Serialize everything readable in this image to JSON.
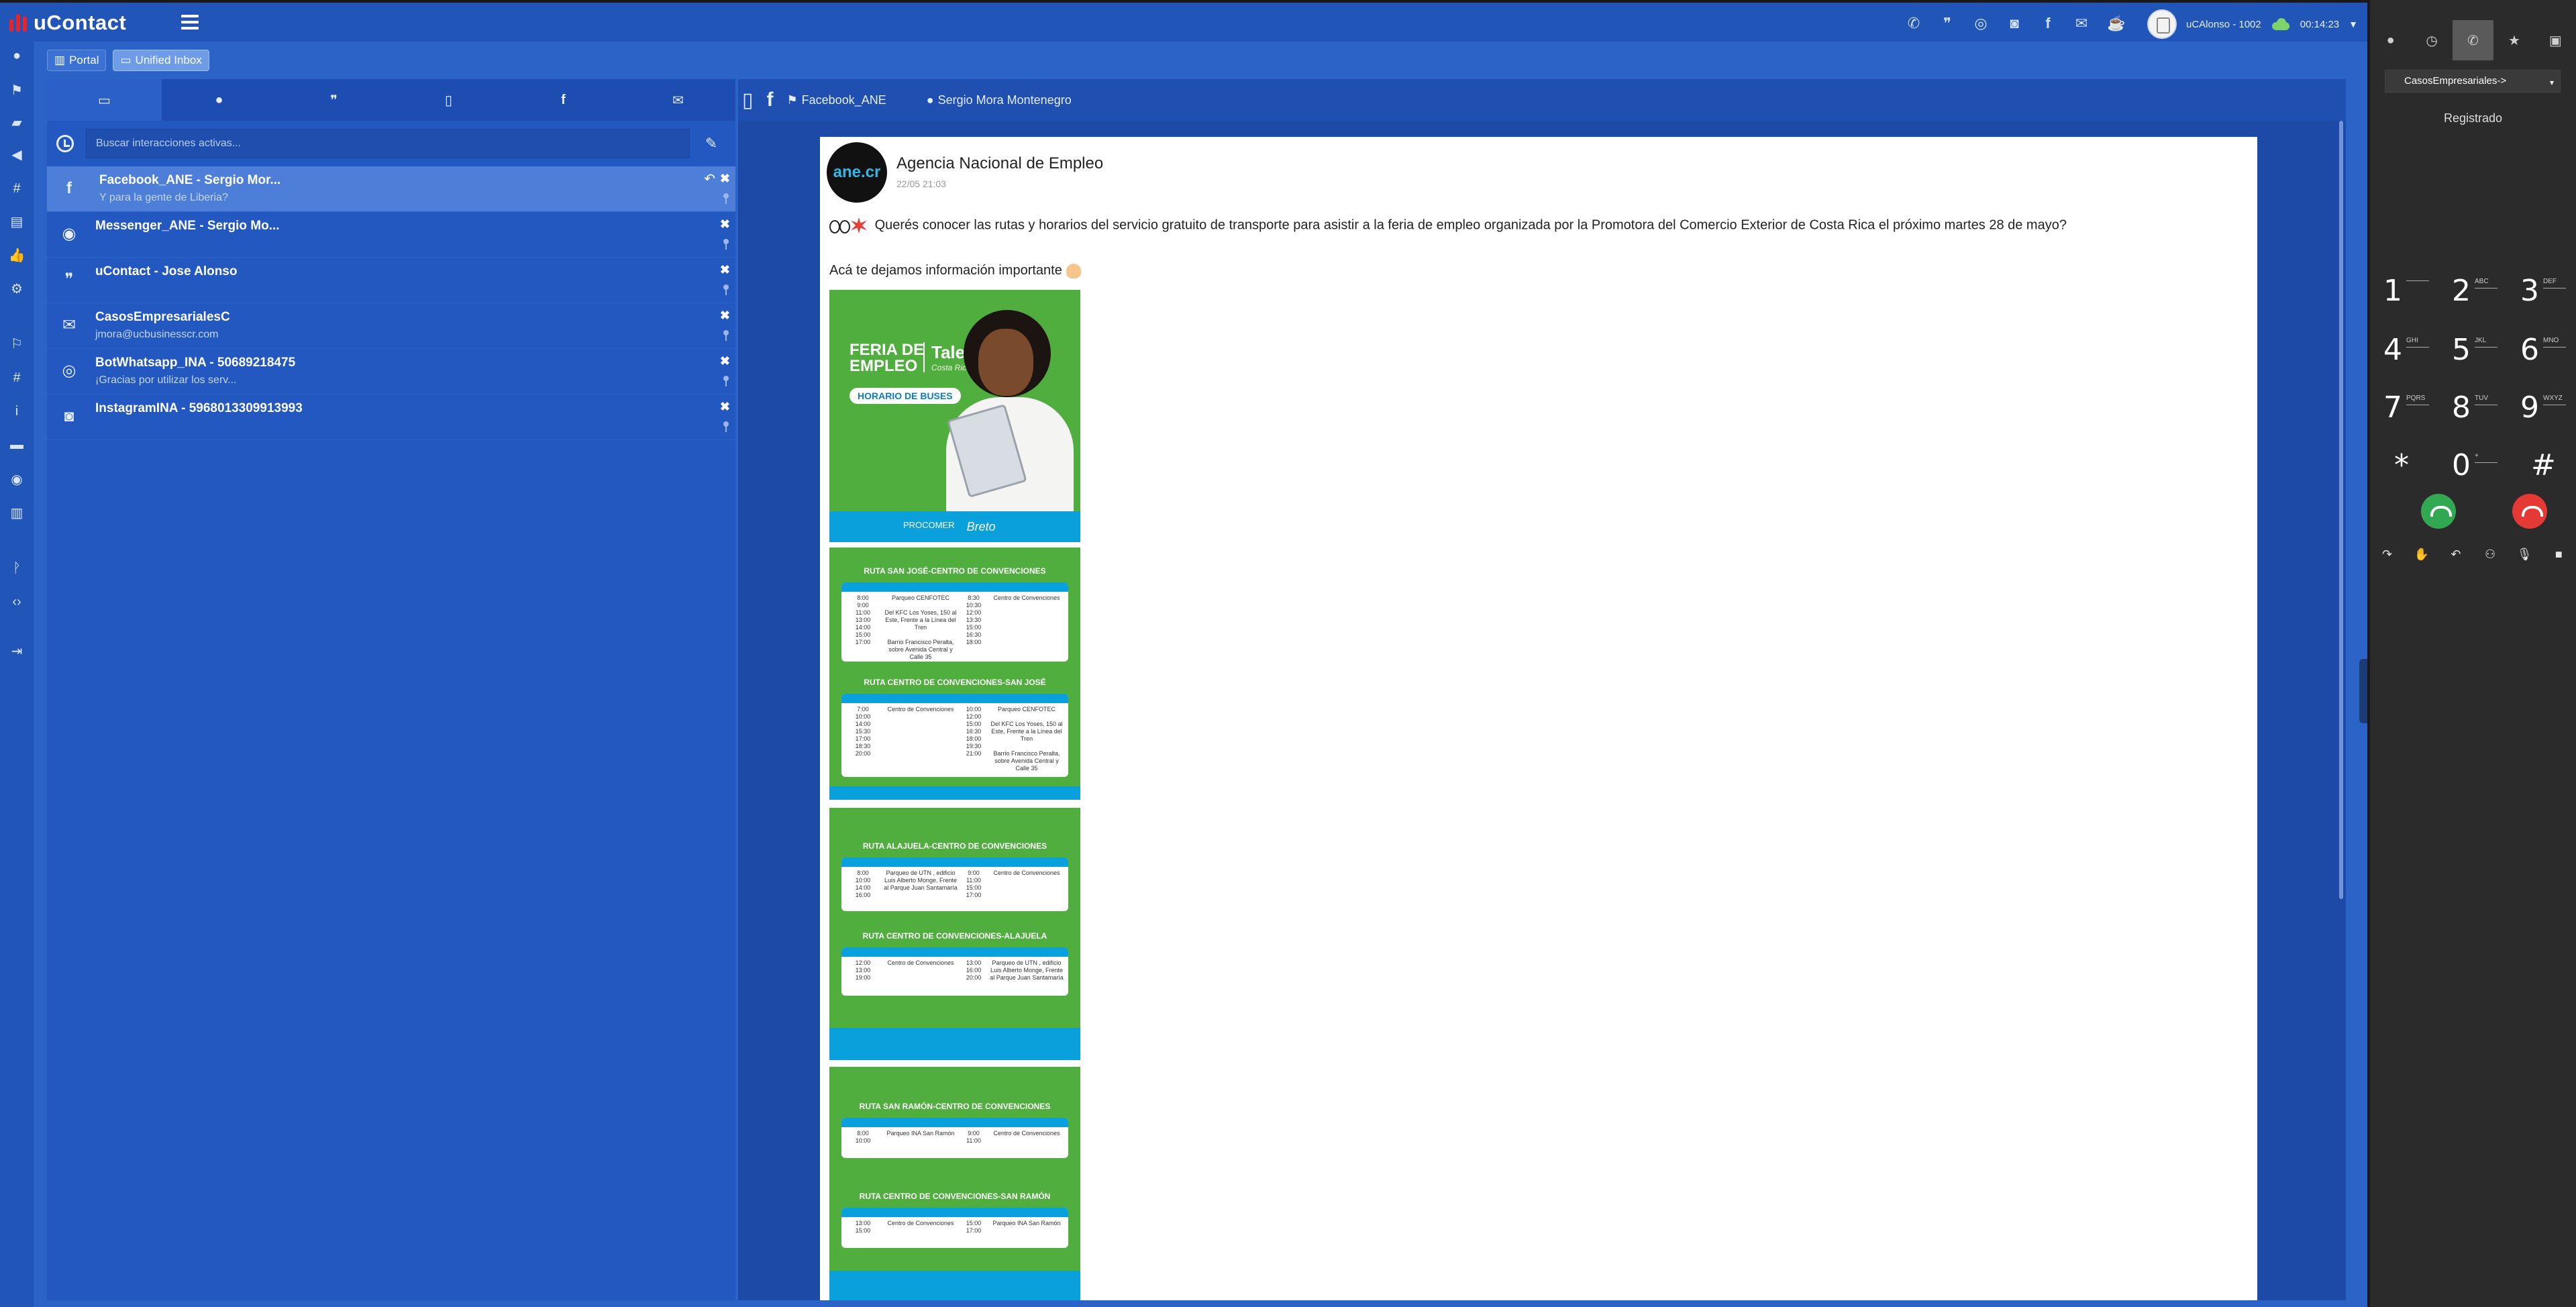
{
  "app": {
    "brand": "uContact"
  },
  "header": {
    "icons": [
      "phone-icon",
      "chat-icon",
      "whatsapp-icon",
      "instagram-icon",
      "facebook-icon",
      "email-icon",
      "coffee-icon"
    ],
    "user_name": "uCAlonso - 1002",
    "timer": "00:14:23"
  },
  "breadcrumbs": [
    {
      "label": "Portal",
      "icon": "chart-icon",
      "active": false
    },
    {
      "label": "Unified Inbox",
      "icon": "inbox-icon",
      "active": true
    }
  ],
  "inbox": {
    "tabs": [
      "inbox-icon",
      "chat-icon",
      "messenger-icon",
      "mobile-icon",
      "facebook-icon",
      "email-icon"
    ],
    "search": {
      "placeholder": "Buscar interacciones activas...",
      "value": ""
    },
    "conversations": [
      {
        "channel": "facebook",
        "title": "Facebook_ANE - Sergio Mor...",
        "subtitle": "Y para la gente de Liberia?",
        "selected": true
      },
      {
        "channel": "messenger",
        "title": "Messenger_ANE - Sergio Mo...",
        "subtitle": "",
        "selected": false
      },
      {
        "channel": "chat",
        "title": "uContact - Jose Alonso",
        "subtitle": "",
        "selected": false
      },
      {
        "channel": "email",
        "title": "CasosEmpresarialesC",
        "subtitle": "jmora@ucbusinesscr.com",
        "selected": false
      },
      {
        "channel": "whatsapp",
        "title": "BotWhatsapp_INA - 50689218475",
        "subtitle": "¡Gracias por utilizar los serv...",
        "selected": false
      },
      {
        "channel": "instagram",
        "title": "InstagramINA - 5968013309913993",
        "subtitle": "",
        "selected": false
      }
    ]
  },
  "chat": {
    "header": {
      "page": "Facebook_ANE",
      "contact": "Sergio Mora Montenegro"
    },
    "post": {
      "avatar_text": "ane.cr",
      "author": "Agencia Nacional de Empleo",
      "date": "22/05 21:03",
      "line1": "Querés conocer las rutas y horarios del servicio gratuito de transporte para asistir a la feria de empleo organizada por la Promotora del Comercio Exterior de Costa Rica el próximo martes 28 de mayo?",
      "line2": "Acá te dejamos información importante"
    },
    "posters": {
      "p1": {
        "title1": "FERIA DE",
        "title2": "EMPLEO",
        "talent": "Talent",
        "talent_sub": "Costa Rica",
        "pill": "HORARIO DE BUSES",
        "logos": [
          "PROCOMER",
          "Breto"
        ]
      },
      "p2": {
        "route_a": "RUTA SAN JOSÉ-CENTRO DE CONVENCIONES",
        "route_b": "RUTA CENTRO DE CONVENCIONES-SAN JOSÉ"
      },
      "p3": {
        "route_a": "RUTA ALAJUELA-CENTRO DE CONVENCIONES",
        "route_b": "RUTA CENTRO DE CONVENCIONES-ALAJUELA"
      },
      "p4": {
        "route_a": "RUTA SAN RAMÓN-CENTRO DE CONVENCIONES",
        "route_b": "RUTA CENTRO DE CONVENCIONES-SAN RAMÓN"
      },
      "tables": {
        "sj_out": {
          "times": "8:00\n9:00\n11:00\n13:00\n14:00\n15:00\n17:00",
          "from": "Parqueo CENFOTEC\n\nDel KFC Los Yoses, 150 al Este, Frente a la Línea del Tren\n\nBarrio Francisco Peralta, sobre Avenida Central y Calle 35",
          "times2": "8:30\n10:30\n12:00\n13:30\n15:00\n16:30\n18:00",
          "to": "Centro de Convenciones"
        },
        "sj_ret": {
          "times": "7:00\n10:00\n14:00\n15:30\n17:00\n18:30\n20:00",
          "from": "Centro de Convenciones",
          "times2": "10:00\n12:00\n15:00\n16:30\n18:00\n19:30\n21:00",
          "to": "Parqueo CENFOTEC\n\nDel KFC Los Yoses, 150 al Este, Frente a la Línea del Tren\n\nBarrio Francisco Peralta, sobre Avenida Central y Calle 35"
        },
        "al_out": {
          "times": "8:00\n10:00\n14:00\n16:00",
          "from": "Parqueo de UTN , edificio Luis Alberto Monge, Frente al Parque Juan Santamaría",
          "times2": "9:00\n11:00\n15:00\n17:00",
          "to": "Centro de Convenciones"
        },
        "al_ret": {
          "times": "12:00\n13:00\n19:00",
          "from": "Centro de Convenciones",
          "times2": "13:00\n16:00\n20:00",
          "to": "Parqueo de UTN , edificio Luis Alberto Monge, Frente al Parque Juan Santamaría"
        },
        "sr_out": {
          "times": "8:00\n10:00",
          "from": "Parqueo INA San Ramón",
          "times2": "9:00\n11:00",
          "to": "Centro de Convenciones"
        },
        "sr_ret": {
          "times": "13:00\n15:00",
          "from": "Centro de Convenciones",
          "times2": "15:00\n17:00",
          "to": "Parqueo INA San Ramón"
        }
      }
    }
  },
  "phone": {
    "tabs": [
      "user-icon",
      "history-icon",
      "phone-icon",
      "star-icon",
      "contacts-icon"
    ],
    "campaign": "CasosEmpresariales->",
    "status": "Registrado",
    "keys": [
      {
        "num": "1",
        "letters": ""
      },
      {
        "num": "2",
        "letters": "ABC"
      },
      {
        "num": "3",
        "letters": "DEF"
      },
      {
        "num": "4",
        "letters": "GHI"
      },
      {
        "num": "5",
        "letters": "JKL"
      },
      {
        "num": "6",
        "letters": "MNO"
      },
      {
        "num": "7",
        "letters": "PQRS"
      },
      {
        "num": "8",
        "letters": "TUV"
      },
      {
        "num": "9",
        "letters": "WXYZ"
      },
      {
        "num": "*",
        "letters": ""
      },
      {
        "num": "0",
        "letters": "+"
      },
      {
        "num": "#",
        "letters": ""
      }
    ],
    "actions": [
      "transfer-icon",
      "hold-icon",
      "back-icon",
      "conference-icon",
      "mute-icon",
      "video-icon"
    ]
  }
}
